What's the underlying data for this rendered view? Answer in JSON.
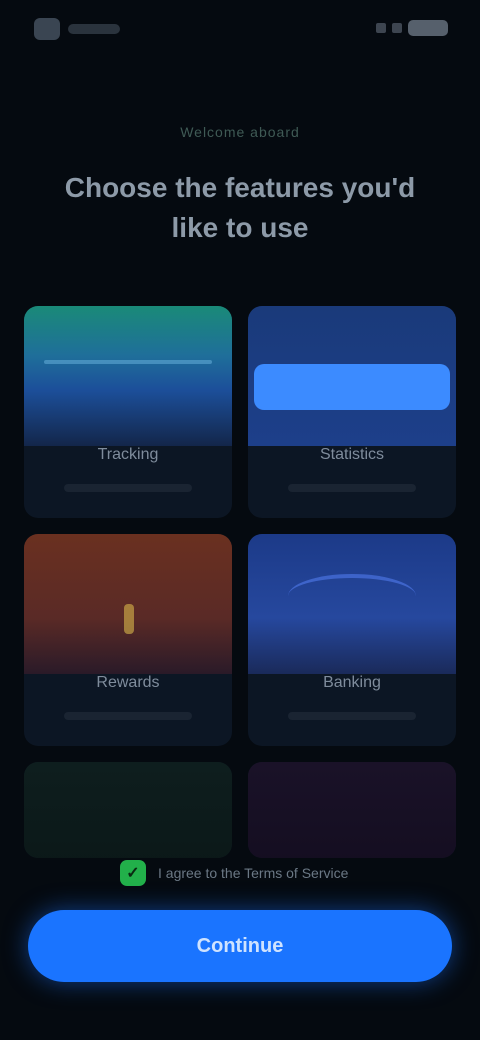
{
  "eyebrow": "Welcome aboard",
  "headline": "Choose the features you'd like to use",
  "cards": [
    {
      "label": "Tracking",
      "icon": "wave-icon"
    },
    {
      "label": "Statistics",
      "icon": "chart-icon"
    },
    {
      "label": "Rewards",
      "icon": "gift-icon"
    },
    {
      "label": "Banking",
      "icon": "bank-icon"
    },
    {
      "label": "",
      "icon": "card-icon"
    },
    {
      "label": "",
      "icon": "card-icon"
    }
  ],
  "agree": {
    "checked": true,
    "text": "I agree to the Terms of Service"
  },
  "cta": {
    "label": "Continue"
  }
}
